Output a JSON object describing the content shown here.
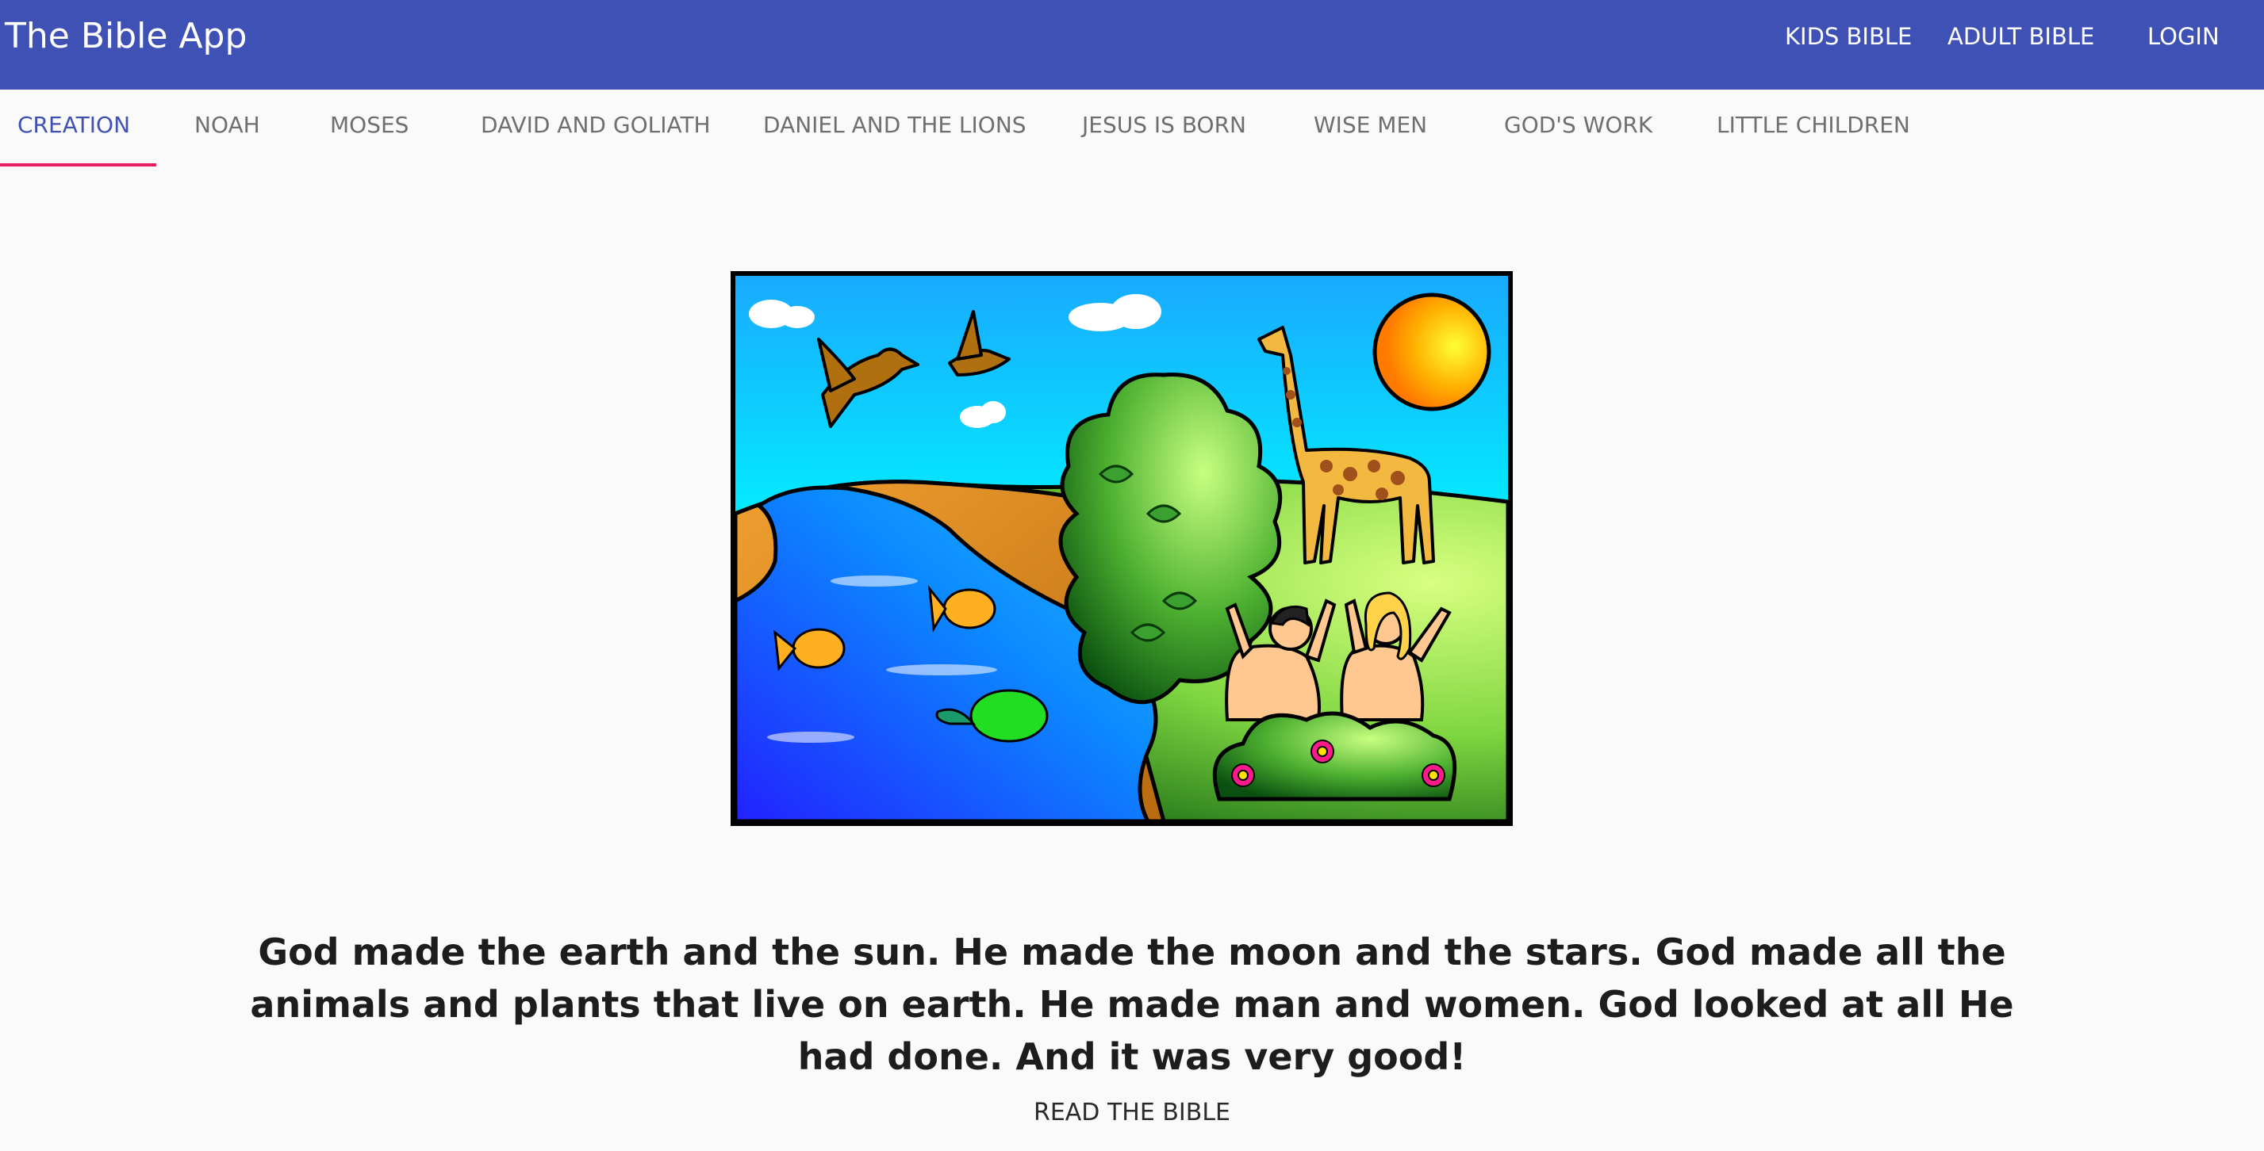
{
  "appbar": {
    "title": "The Bible App",
    "nav": {
      "kids_bible": "Kids Bible",
      "adult_bible": "Adult Bible",
      "login": "Login"
    },
    "color": "#3f51b5"
  },
  "tabs": [
    {
      "label": "Creation",
      "active": true
    },
    {
      "label": "Noah"
    },
    {
      "label": "Moses"
    },
    {
      "label": "David and Goliath"
    },
    {
      "label": "Daniel and the Lions"
    },
    {
      "label": "Jesus is Born"
    },
    {
      "label": "Wise Men"
    },
    {
      "label": "God's Work"
    },
    {
      "label": "Little Children"
    }
  ],
  "tab_indicator_color": "#e91e63",
  "story": {
    "text": "God made the earth and the sun. He made the moon and the stars. God made all the animals and plants that live on earth. He made man and women. God looked at all He had done. And it was very good!",
    "read_link": "Read the Bible"
  }
}
